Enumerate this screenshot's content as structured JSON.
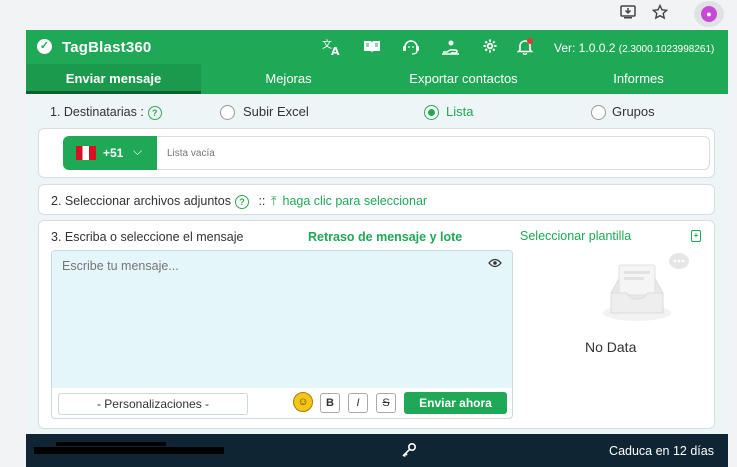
{
  "browser": {
    "icons": [
      "install-app-icon",
      "star-icon",
      "extension-icon"
    ]
  },
  "header": {
    "app_name": "TagBlast360",
    "version_label": "Ver: 1.0.0.2",
    "version_build": "(2.3000.1023998261)",
    "icons": [
      "translate-icon",
      "book-icon",
      "support-icon",
      "hand-icon",
      "gear-icon",
      "bell-icon"
    ]
  },
  "tabs": [
    {
      "label": "Enviar mensaje",
      "active": true
    },
    {
      "label": "Mejoras",
      "active": false
    },
    {
      "label": "Exportar contactos",
      "active": false
    },
    {
      "label": "Informes",
      "active": false
    }
  ],
  "recipients": {
    "label": "1. Destinatarias :",
    "help": "?",
    "options": [
      {
        "label": "Subir Excel",
        "selected": false
      },
      {
        "label": "Lista",
        "selected": true
      },
      {
        "label": "Grupos",
        "selected": false
      }
    ]
  },
  "phone": {
    "country_code": "+51",
    "flag": "Peru",
    "chevron": "⌵",
    "placeholder": "Lista vacía"
  },
  "attachments": {
    "label": "2. Seleccionar archivos adjuntos",
    "help": "?",
    "separator": "::",
    "link": "haga clic para seleccionar"
  },
  "message": {
    "label": "3. Escriba o seleccione el mensaje",
    "delay_link": "Retraso de mensaje y lote",
    "placeholder": "Escribe tu mensaje...",
    "personalize": "- Personalizaciones -",
    "bold": "B",
    "italic": "I",
    "strike": "S",
    "send": "Enviar ahora"
  },
  "templates": {
    "label": "Seleccionar plantilla",
    "empty": "No Data"
  },
  "footer": {
    "expires": "Caduca en 12 días"
  },
  "colors": {
    "brand_green": "#1fa855",
    "footer_dark": "#0f2533",
    "message_bg": "#e5f6fb"
  }
}
